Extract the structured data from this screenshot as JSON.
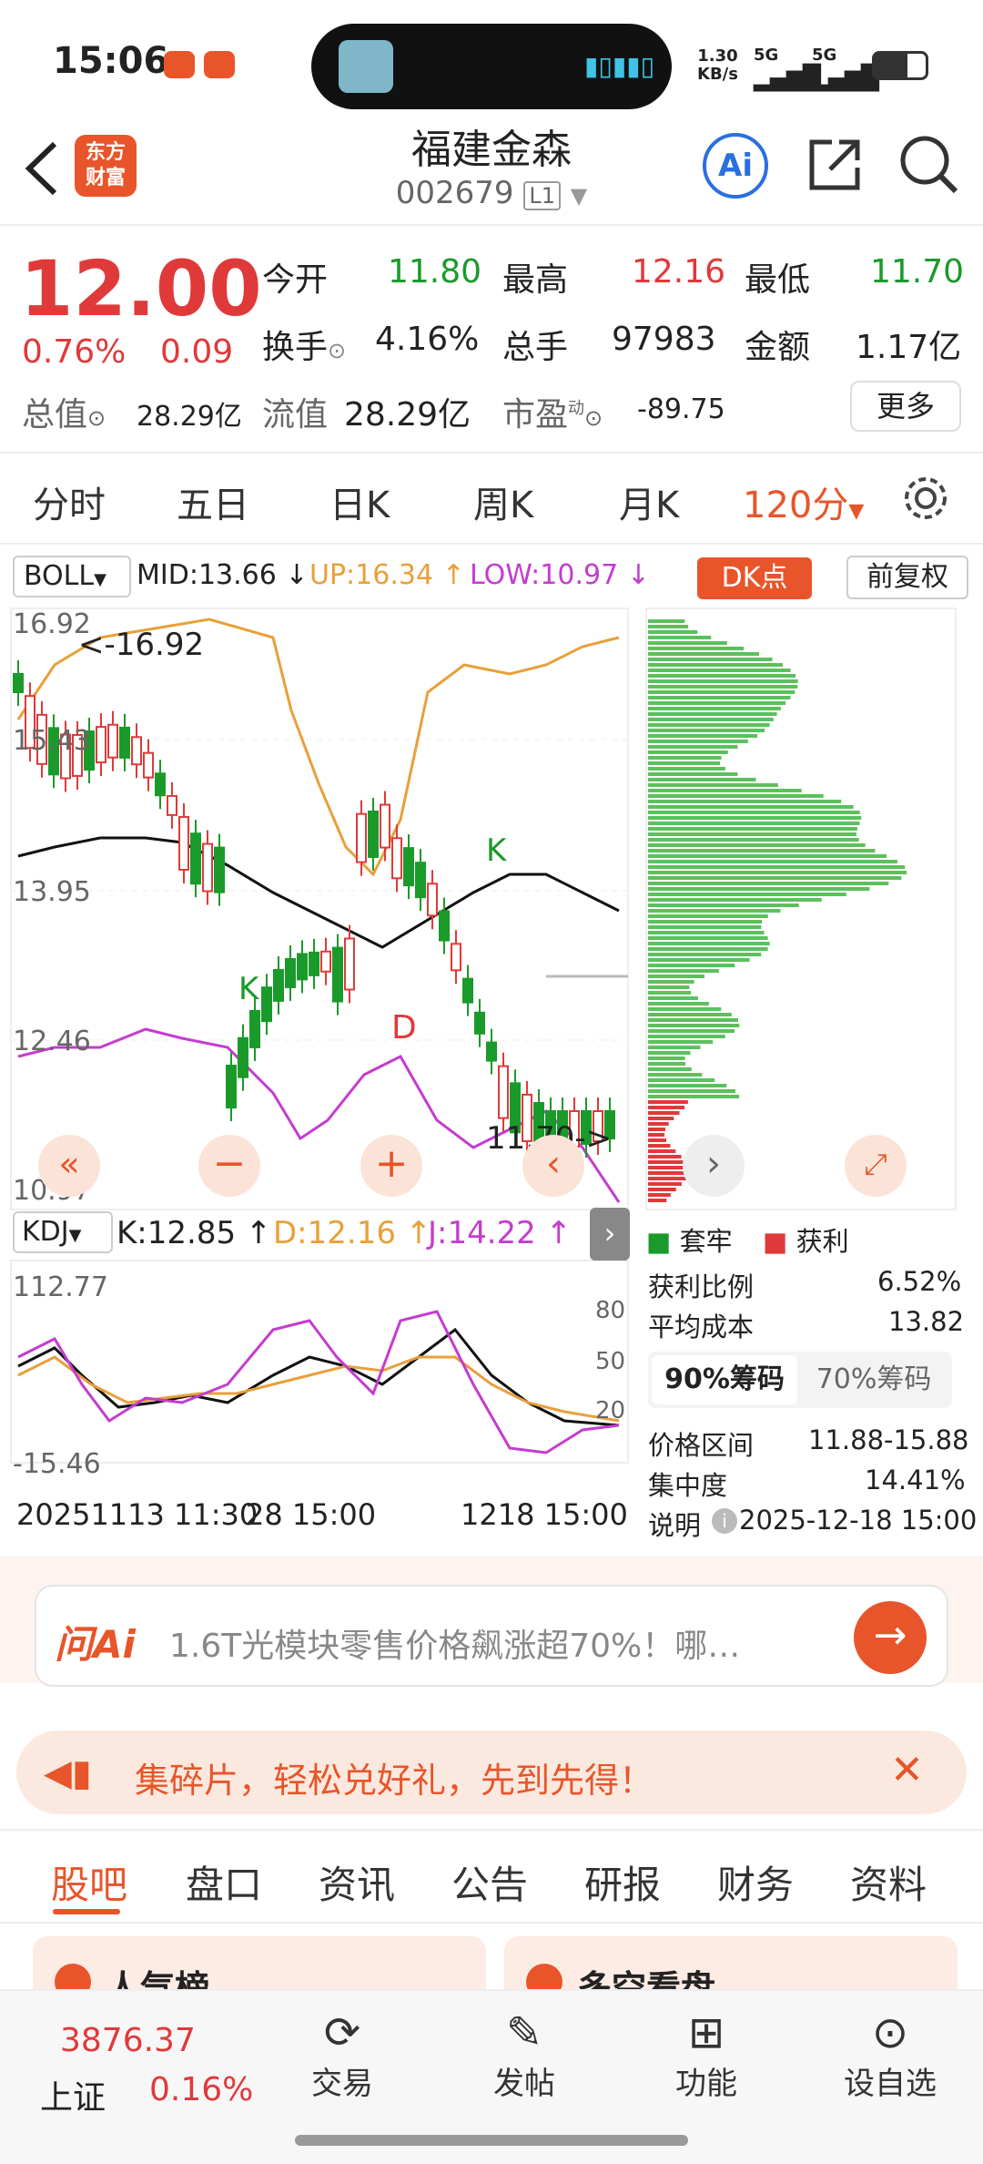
{
  "status_bar": {
    "time": "15:06",
    "net_speed_top": "1.30",
    "net_speed_unit": "KB/s",
    "sig1": "5G",
    "sig2": "5G"
  },
  "header": {
    "name": "福建金森",
    "code": "002679",
    "market_badge": "L1",
    "logo_text_1": "东方",
    "logo_text_2": "财富",
    "ai_label": "Ai"
  },
  "quote": {
    "price": "12.00",
    "change_pct": "0.76%",
    "change_amt": "0.09",
    "open_label": "今开",
    "open": "11.80",
    "high_label": "最高",
    "high": "12.16",
    "low_label": "最低",
    "low": "11.70",
    "turnover_label": "换手",
    "turnover": "4.16%",
    "volume_label": "总手",
    "volume": "97983",
    "amount_label": "金额",
    "amount": "1.17亿",
    "total_mv_label": "总值",
    "total_mv": "28.29亿",
    "float_mv_label": "流值",
    "float_mv": "28.29亿",
    "pe_label": "市盈",
    "pe_sup": "动",
    "pe": "-89.75",
    "more_button": "更多"
  },
  "period_tabs": [
    "分时",
    "五日",
    "日K",
    "周K",
    "月K",
    "120分"
  ],
  "boll": {
    "name": "BOLL",
    "mid": "MID:13.66 ↓",
    "up": "UP:16.34 ↑",
    "low": "LOW:10.97 ↓",
    "dk_button": "DK点",
    "fuquan_button": "前复权"
  },
  "price_axis": [
    "16.92",
    "15.43",
    "13.95",
    "12.46",
    "10.97"
  ],
  "annotations": {
    "high_marker": "<-16.92",
    "low_marker": "11.70->",
    "k1": "K",
    "k2": "K",
    "d1": "D"
  },
  "kdj": {
    "name": "KDJ",
    "k": "K:12.85 ↑",
    "d": "D:12.16 ↑",
    "j": "J:14.22 ↑",
    "top": "112.77",
    "bottom": "-15.46",
    "l80": "80",
    "l50": "50",
    "l20": "20"
  },
  "time_axis": {
    "left": "20251113 11:30",
    "mid": "28 15:00",
    "right": "1218 15:00"
  },
  "chip": {
    "legend_trapped": "套牢",
    "legend_profit": "获利",
    "profit_ratio_label": "获利比例",
    "profit_ratio": "6.52%",
    "avg_cost_label": "平均成本",
    "avg_cost": "13.82",
    "tab_90": "90%筹码",
    "tab_70": "70%筹码",
    "range_label": "价格区间",
    "range": "11.88-15.88",
    "concentration_label": "集中度",
    "concentration": "14.41%",
    "note_label": "说明",
    "note_time": "2025-12-18 15:00"
  },
  "ai_bar": {
    "logo": "问Ai",
    "text": "1.6T光模块零售价格飙涨超70%！哪…"
  },
  "promo": {
    "text": "集碎片，轻松兑好礼，先到先得！"
  },
  "content_tabs": [
    "股吧",
    "盘口",
    "资讯",
    "公告",
    "研报",
    "财务",
    "资料"
  ],
  "cards": {
    "left": "人气榜",
    "right": "多空看盘"
  },
  "bottom_nav": {
    "index_value": "3876.37",
    "index_name": "上证",
    "index_pct": "0.16%",
    "items": [
      "交易",
      "发帖",
      "功能",
      "设自选"
    ]
  },
  "colors": {
    "up": "#e0393a",
    "down": "#1a9a2a",
    "accent": "#e8552a",
    "mid_line": "#111111",
    "up_line": "#e8a03a",
    "low_line": "#c43ccf"
  }
}
